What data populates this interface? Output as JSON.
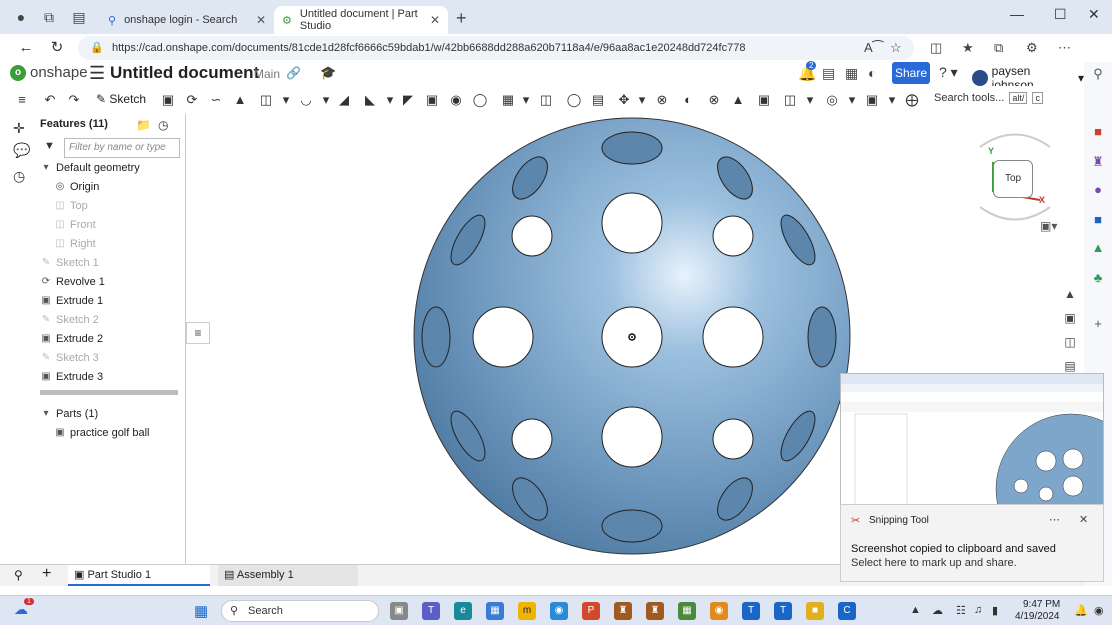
{
  "browser": {
    "tabs": [
      {
        "label": "onshape login - Search",
        "icon": "search-favicon"
      },
      {
        "label": "Untitled document | Part Studio",
        "icon": "onshape-favicon"
      }
    ],
    "url": "https://cad.onshape.com/documents/81cde1d28fcf6666c59bdab1/w/42bb6688dd288a620b7118a4/e/96aa8ac1e20248dd724fc778"
  },
  "header": {
    "logo_text": "onshape",
    "doc_title": "Untitled document",
    "branch": "Main",
    "notification_count": "2",
    "share_label": "Share",
    "user_name": "paysen johnson",
    "accent": "#2a6ad8"
  },
  "toolbar": {
    "sketch_label": "Sketch",
    "search_tools_label": "Search tools...",
    "search_tools_shortcut": "alt/",
    "search_tools_key": "c"
  },
  "feature_tree": {
    "title": "Features (11)",
    "filter_placeholder": "Filter by name or type",
    "group_label": "Default geometry",
    "default_geometry": [
      "Origin",
      "Top",
      "Front",
      "Right"
    ],
    "features": [
      {
        "label": "Sketch 1",
        "dim": true
      },
      {
        "label": "Revolve 1",
        "dim": false
      },
      {
        "label": "Extrude 1",
        "dim": false
      },
      {
        "label": "Sketch 2",
        "dim": true
      },
      {
        "label": "Extrude 2",
        "dim": false
      },
      {
        "label": "Sketch 3",
        "dim": true
      },
      {
        "label": "Extrude 3",
        "dim": false
      }
    ],
    "parts_label": "Parts (1)",
    "parts": [
      "practice golf ball"
    ]
  },
  "viewcube": {
    "face": "Top",
    "axis_y": "Y",
    "axis_x": "X"
  },
  "bottom_tabs": [
    {
      "label": "Part Studio 1"
    },
    {
      "label": "Assembly 1"
    }
  ],
  "notification": {
    "app": "Snipping Tool",
    "title": "Screenshot copied to clipboard and saved",
    "body": "Select here to mark up and share."
  },
  "taskbar": {
    "search_placeholder": "Search",
    "time": "9:47 PM",
    "date": "4/19/2024",
    "badge": "1"
  }
}
